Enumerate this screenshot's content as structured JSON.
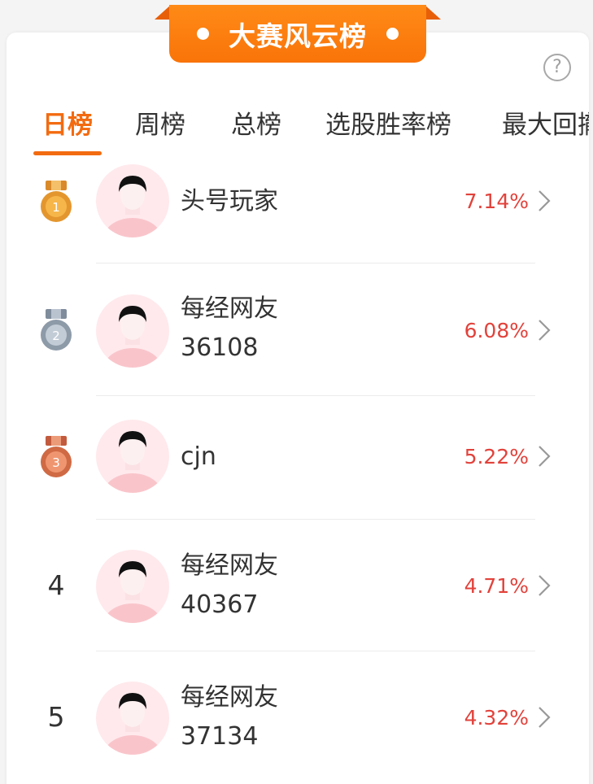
{
  "banner": {
    "title": "大赛风云榜"
  },
  "help_icon": "?",
  "tabs": [
    {
      "label": "日榜",
      "active": true
    },
    {
      "label": "周榜",
      "active": false
    },
    {
      "label": "总榜",
      "active": false
    },
    {
      "label": "选股胜率榜",
      "active": false
    },
    {
      "label": "最大回撤",
      "active": false
    }
  ],
  "ranking": [
    {
      "rank": "1",
      "medal": "gold-medal-icon",
      "name_line1": "头号玩家",
      "name_line2": "",
      "pct": "7.14%"
    },
    {
      "rank": "2",
      "medal": "silver-medal-icon",
      "name_line1": "每经网友",
      "name_line2": "36108",
      "pct": "6.08%"
    },
    {
      "rank": "3",
      "medal": "bronze-medal-icon",
      "name_line1": "cjn",
      "name_line2": "",
      "pct": "5.22%"
    },
    {
      "rank": "4",
      "medal": "",
      "name_line1": "每经网友",
      "name_line2": "40367",
      "pct": "4.71%"
    },
    {
      "rank": "5",
      "medal": "",
      "name_line1": "每经网友",
      "name_line2": "37134",
      "pct": "4.32%"
    }
  ],
  "colors": {
    "accent": "#f36b10",
    "positive": "#e2423b",
    "banner": "#f97409"
  }
}
